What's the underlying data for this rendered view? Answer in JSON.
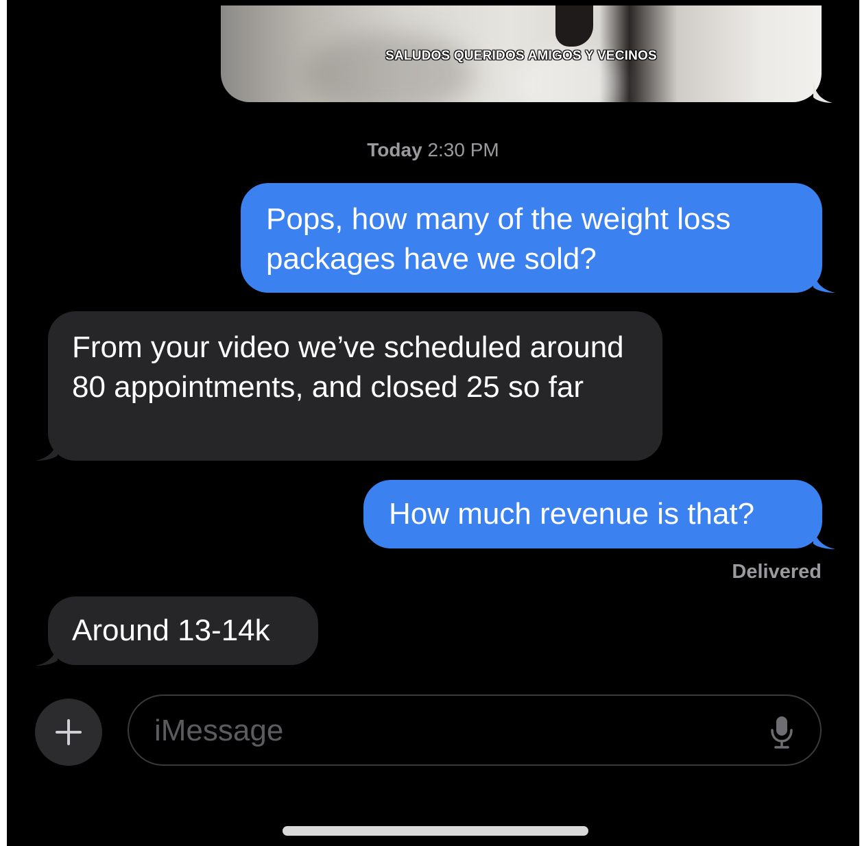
{
  "media": {
    "caption": "SALUDOS QUERIDOS AMIGOS Y VECINOS"
  },
  "timestamp": {
    "day": "Today",
    "time": "2:30 PM"
  },
  "messages": [
    {
      "direction": "sent",
      "text": "Pops, how many of the weight loss packages have we sold?"
    },
    {
      "direction": "received",
      "text": "From your video we’ve scheduled around 80 appointments, and closed 25 so far"
    },
    {
      "direction": "sent",
      "text": "How much revenue is that?"
    },
    {
      "direction": "received",
      "text": "Around 13-14k"
    }
  ],
  "status": {
    "delivered": "Delivered"
  },
  "composer": {
    "placeholder": "iMessage",
    "plus_icon": "plus-icon",
    "mic_icon": "microphone-icon"
  },
  "colors": {
    "sent_bubble": "#3b82f0",
    "received_bubble": "#262628",
    "background": "#000000"
  }
}
